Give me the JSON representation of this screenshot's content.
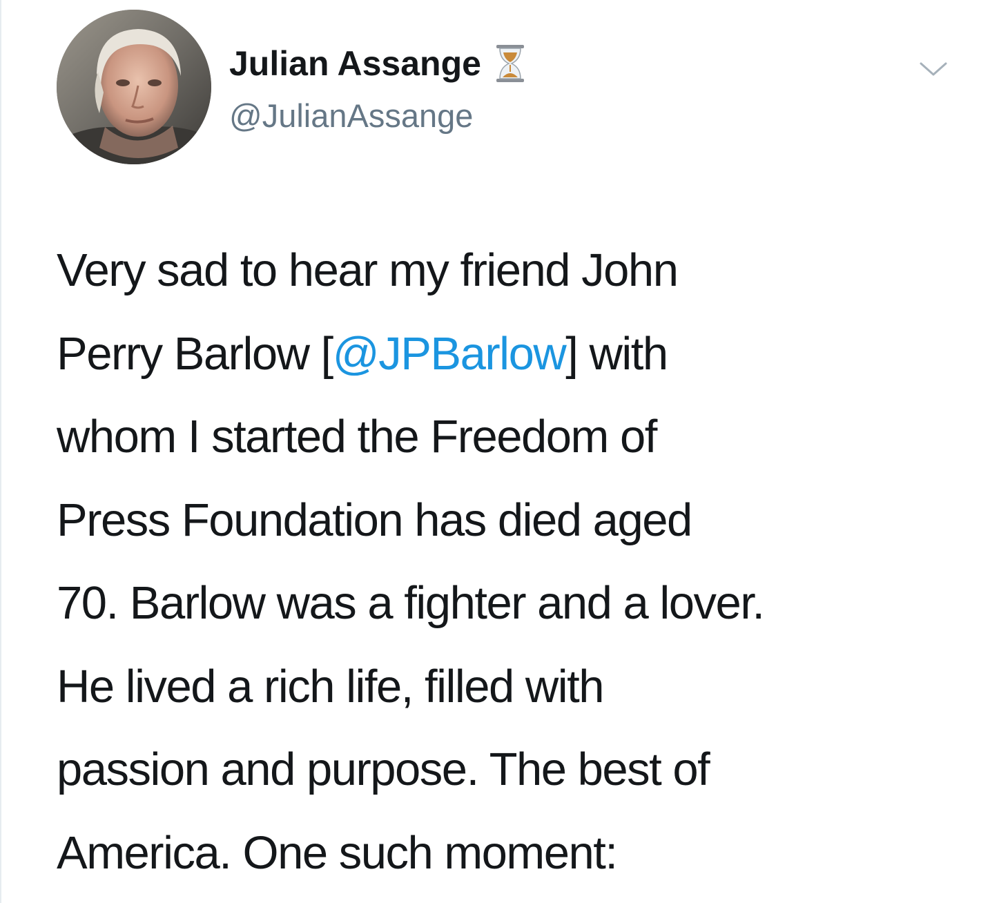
{
  "tweet": {
    "display_name": "Julian Assange",
    "username": "@JulianAssange",
    "verified_emoji": "hourglass-emoji",
    "caret_icon": "chevron-down-icon",
    "colors": {
      "text": "#14171a",
      "secondary": "#657786",
      "link": "#1b95e0"
    },
    "body": {
      "line1": "Very sad to hear my friend John",
      "line2_before": "Perry Barlow [",
      "mention": "@JPBarlow",
      "line2_after": "] with",
      "line3": "whom I started the Freedom of",
      "line4": "Press Foundation has died aged",
      "line5": "70. Barlow was a fighter and a lover.",
      "line6": "He lived a rich life, filled with",
      "line7": "passion and purpose. The best of",
      "line8": "America. One such moment:"
    }
  }
}
